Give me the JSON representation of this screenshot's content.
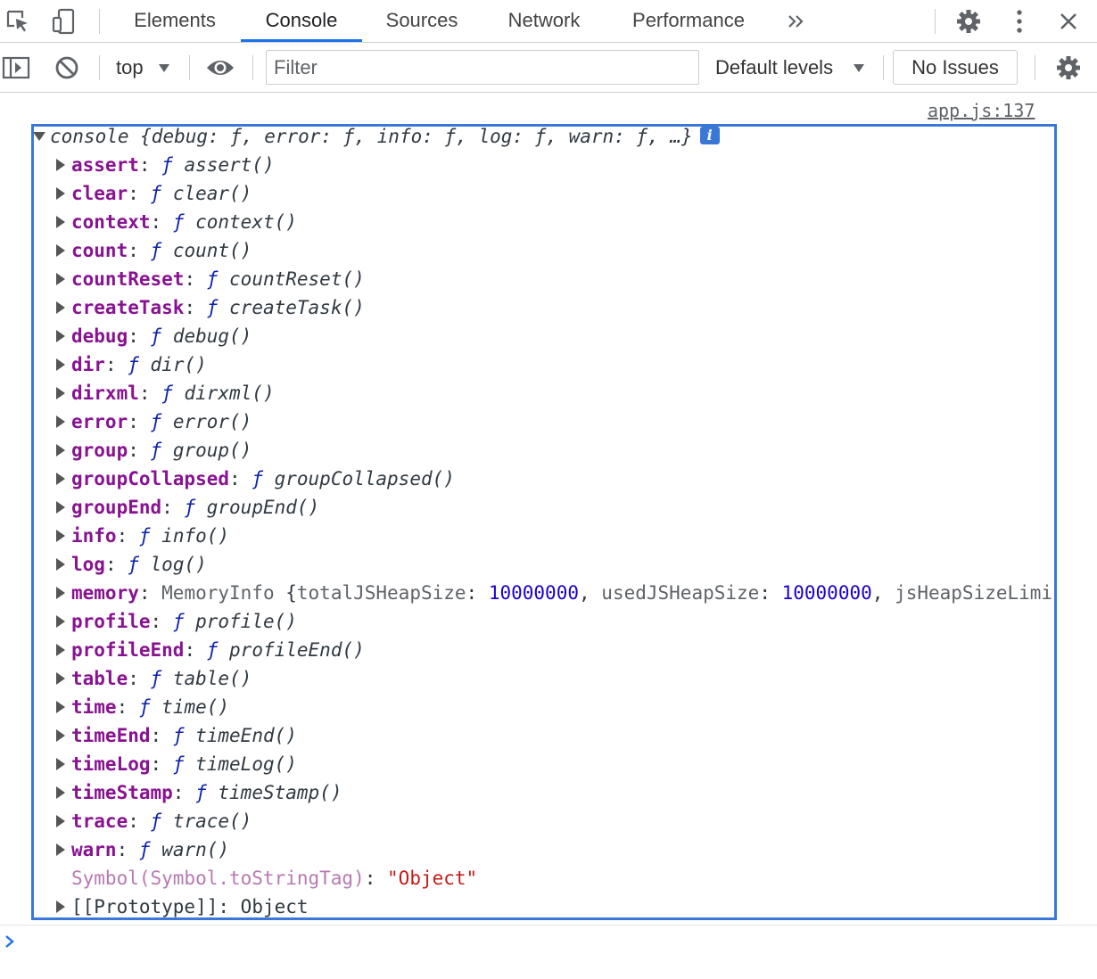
{
  "tabs": [
    {
      "label": "Elements",
      "active": false
    },
    {
      "label": "Console",
      "active": true
    },
    {
      "label": "Sources",
      "active": false
    },
    {
      "label": "Network",
      "active": false
    },
    {
      "label": "Performance",
      "active": false
    }
  ],
  "toolbar": {
    "context": "top",
    "filter_placeholder": "Filter",
    "levels": "Default levels",
    "issues": "No Issues"
  },
  "output": {
    "source_link": "app.js:137",
    "summary": {
      "name": "console",
      "preview": "{debug: ƒ, error: ƒ, info: ƒ, log: ƒ, warn: ƒ, …}"
    },
    "methods": [
      {
        "key": "assert",
        "fn": "assert()"
      },
      {
        "key": "clear",
        "fn": "clear()"
      },
      {
        "key": "context",
        "fn": "context()"
      },
      {
        "key": "count",
        "fn": "count()"
      },
      {
        "key": "countReset",
        "fn": "countReset()"
      },
      {
        "key": "createTask",
        "fn": "createTask()"
      },
      {
        "key": "debug",
        "fn": "debug()"
      },
      {
        "key": "dir",
        "fn": "dir()"
      },
      {
        "key": "dirxml",
        "fn": "dirxml()"
      },
      {
        "key": "error",
        "fn": "error()"
      },
      {
        "key": "group",
        "fn": "group()"
      },
      {
        "key": "groupCollapsed",
        "fn": "groupCollapsed()"
      },
      {
        "key": "groupEnd",
        "fn": "groupEnd()"
      },
      {
        "key": "info",
        "fn": "info()"
      }
    ],
    "memory": {
      "key": "memory",
      "type": "MemoryInfo",
      "open": "{",
      "p1": "totalJSHeapSize",
      "v1": "10000000",
      "p2": "usedJSHeapSize",
      "v2": "10000000",
      "p3": "jsHeapSizeLimit"
    },
    "methods2": [
      {
        "key": "profile",
        "fn": "profile()"
      },
      {
        "key": "profileEnd",
        "fn": "profileEnd()"
      },
      {
        "key": "table",
        "fn": "table()"
      },
      {
        "key": "time",
        "fn": "time()"
      },
      {
        "key": "timeEnd",
        "fn": "timeEnd()"
      },
      {
        "key": "timeLog",
        "fn": "timeLog()"
      },
      {
        "key": "timeStamp",
        "fn": "timeStamp()"
      },
      {
        "key": "trace",
        "fn": "trace()"
      },
      {
        "key": "warn",
        "fn": "warn()"
      }
    ],
    "log_entry": {
      "key": "log",
      "fn": "log()"
    },
    "symbol": {
      "key": "Symbol(Symbol.toStringTag)",
      "value": "\"Object\""
    },
    "prototype": {
      "key": "[[Prototype]]",
      "value": "Object"
    },
    "fn_marker": "ƒ"
  },
  "colors": {
    "accent": "#1a73e8",
    "highlight_border": "#3a78d8",
    "key": "#881391",
    "number": "#1c00cf",
    "string": "#c41a16"
  }
}
